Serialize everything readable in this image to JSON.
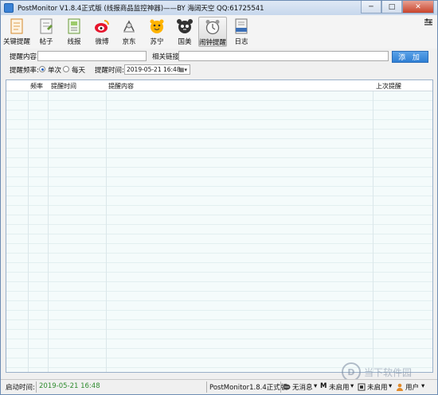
{
  "window": {
    "title": "PostMonitor V1.8.4正式版 (线报商品监控神器)——BY 海阔天空 QQ:61725541",
    "minimize": "─",
    "maximize": "□",
    "close": "✕"
  },
  "toolbar": {
    "items": [
      {
        "label": "关键提醒",
        "icon": "document-icon"
      },
      {
        "label": "帖子",
        "icon": "post-icon"
      },
      {
        "label": "线报",
        "icon": "news-icon"
      },
      {
        "label": "微博",
        "icon": "weibo-icon"
      },
      {
        "label": "京东",
        "icon": "jd-icon"
      },
      {
        "label": "苏宁",
        "icon": "suning-icon"
      },
      {
        "label": "国美",
        "icon": "gome-icon"
      },
      {
        "label": "闹钟提醒",
        "icon": "alarm-clock-icon"
      },
      {
        "label": "日志",
        "icon": "log-icon"
      }
    ],
    "active_index": 7
  },
  "form": {
    "content_label": "提醒内容:",
    "content_value": "",
    "link_label": "相关链接:",
    "link_value": "",
    "add_button": "添 加",
    "frequency_label": "提醒频率:",
    "option_once": "单次",
    "option_daily": "每天",
    "selected_frequency": "单次",
    "time_label": "提醒时间:",
    "time_value": "2019-05-21 16:48"
  },
  "table": {
    "columns": [
      "频率",
      "提醒时间",
      "提醒内容",
      "上次提醒"
    ],
    "rows": []
  },
  "statusbar": {
    "start_label": "启动时间:",
    "start_time": "2019-05-21 16:48",
    "version": "PostMonitor1.8.4正式版",
    "no_message": "无消息",
    "not_enabled_1": "未启用",
    "not_enabled_2": "未启用",
    "user": "用户"
  },
  "watermark": {
    "text": "当下软件园"
  }
}
